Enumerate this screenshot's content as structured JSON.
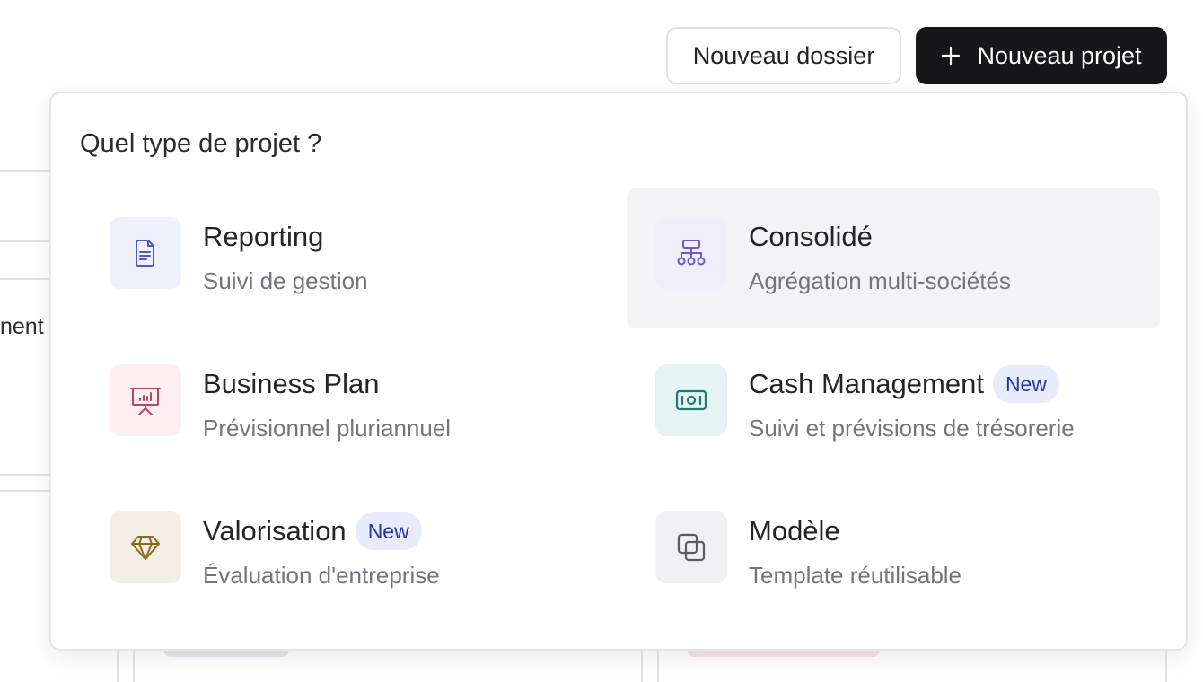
{
  "header": {
    "new_folder_label": "Nouveau dossier",
    "new_project_label": "Nouveau projet"
  },
  "background": {
    "partial_text": "nent"
  },
  "menu": {
    "title": "Quel type de projet ?",
    "options": [
      {
        "title": "Reporting",
        "description": "Suivi de gestion",
        "badge": "",
        "icon": "document-icon",
        "icon_color": "#4f5bc0",
        "icon_bg": "#eef0fc"
      },
      {
        "title": "Consolidé",
        "description": "Agrégation multi-sociétés",
        "badge": "",
        "icon": "hierarchy-icon",
        "icon_color": "#6f58c9",
        "icon_bg": "#f1eefb"
      },
      {
        "title": "Business Plan",
        "description": "Prévisionnel pluriannuel",
        "badge": "",
        "icon": "presentation-chart-icon",
        "icon_color": "#b24a62",
        "icon_bg": "#fdeef2"
      },
      {
        "title": "Cash Management",
        "description": "Suivi et prévisions de trésorerie",
        "badge": "New",
        "icon": "banknote-icon",
        "icon_color": "#1f7a78",
        "icon_bg": "#e5f3f2"
      },
      {
        "title": "Valorisation",
        "description": "Évaluation d'entreprise",
        "badge": "New",
        "icon": "diamond-icon",
        "icon_color": "#8a6a1d",
        "icon_bg": "#f3efe6"
      },
      {
        "title": "Modèle",
        "description": "Template réutilisable",
        "badge": "",
        "icon": "copy-icon",
        "icon_color": "#5b5b63",
        "icon_bg": "#f0f0f2"
      }
    ]
  }
}
